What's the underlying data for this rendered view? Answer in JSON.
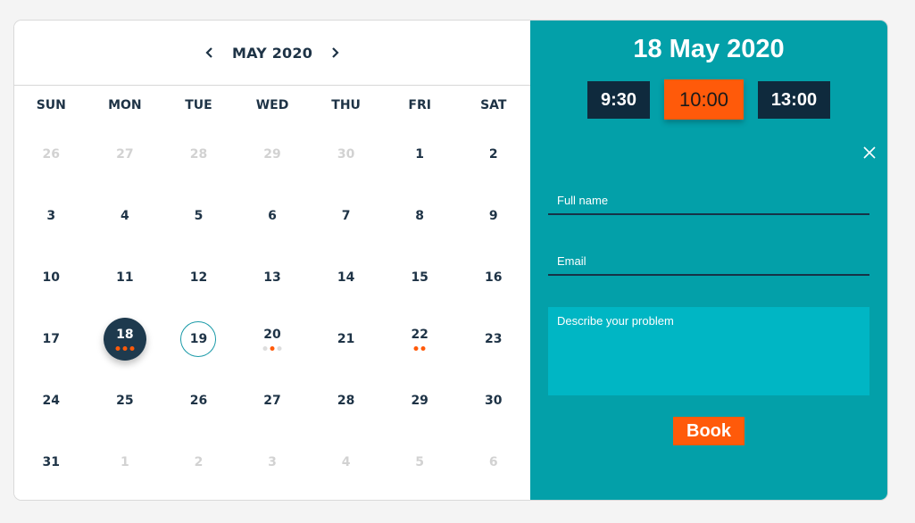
{
  "calendar": {
    "month_label": "MAY 2020",
    "weekdays": [
      "SUN",
      "MON",
      "TUE",
      "WED",
      "THU",
      "FRI",
      "SAT"
    ],
    "weeks": [
      [
        {
          "d": "26",
          "muted": true
        },
        {
          "d": "27",
          "muted": true
        },
        {
          "d": "28",
          "muted": true
        },
        {
          "d": "29",
          "muted": true
        },
        {
          "d": "30",
          "muted": true
        },
        {
          "d": "1"
        },
        {
          "d": "2"
        }
      ],
      [
        {
          "d": "3"
        },
        {
          "d": "4"
        },
        {
          "d": "5"
        },
        {
          "d": "6"
        },
        {
          "d": "7"
        },
        {
          "d": "8"
        },
        {
          "d": "9"
        }
      ],
      [
        {
          "d": "10"
        },
        {
          "d": "11"
        },
        {
          "d": "12"
        },
        {
          "d": "13"
        },
        {
          "d": "14"
        },
        {
          "d": "15"
        },
        {
          "d": "16"
        }
      ],
      [
        {
          "d": "17"
        },
        {
          "d": "18",
          "selected": true,
          "dots": [
            "#ff5a0a",
            "#ff5a0a",
            "#ff5a0a"
          ]
        },
        {
          "d": "19",
          "today": true
        },
        {
          "d": "20",
          "dots": [
            "#dddddd",
            "#ff5a0a",
            "#dddddd"
          ]
        },
        {
          "d": "21"
        },
        {
          "d": "22",
          "dots": [
            "#ff5a0a",
            "#ff5a0a"
          ]
        },
        {
          "d": "23"
        }
      ],
      [
        {
          "d": "24"
        },
        {
          "d": "25"
        },
        {
          "d": "26"
        },
        {
          "d": "27"
        },
        {
          "d": "28"
        },
        {
          "d": "29"
        },
        {
          "d": "30"
        }
      ],
      [
        {
          "d": "31"
        },
        {
          "d": "1",
          "muted": true
        },
        {
          "d": "2",
          "muted": true
        },
        {
          "d": "3",
          "muted": true
        },
        {
          "d": "4",
          "muted": true
        },
        {
          "d": "5",
          "muted": true
        },
        {
          "d": "6",
          "muted": true
        }
      ]
    ]
  },
  "booking": {
    "date_title": "18 May 2020",
    "slots": [
      "9:30",
      "10:00",
      "13:00"
    ],
    "selected_slot": "10:00",
    "fullname_placeholder": "Full name",
    "email_placeholder": "Email",
    "problem_placeholder": "Describe your problem",
    "book_label": "Book",
    "close_icon": "close-icon"
  },
  "colors": {
    "accent_teal": "#03a0a9",
    "accent_orange": "#ff5a0a",
    "navy": "#1e3a4e"
  }
}
